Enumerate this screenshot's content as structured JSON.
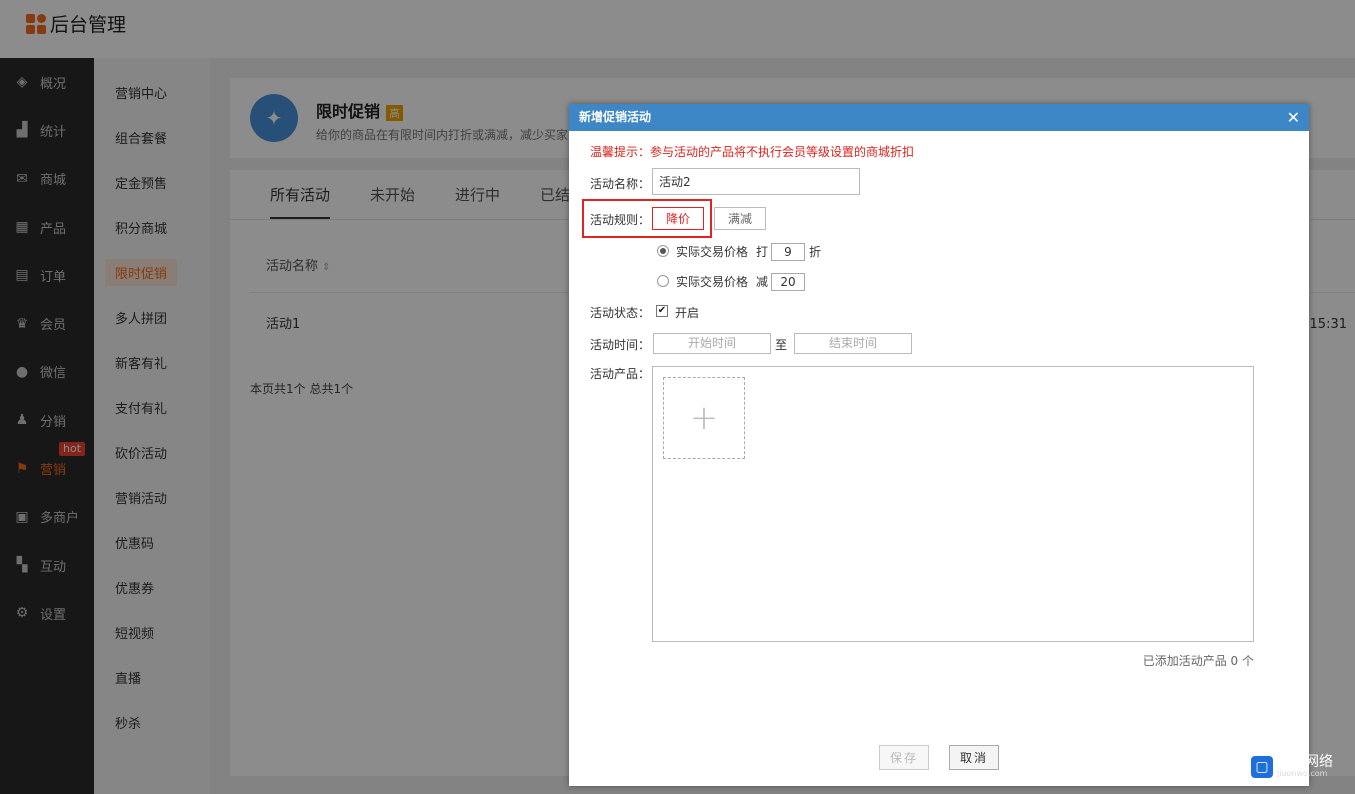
{
  "app": {
    "title": "后台管理"
  },
  "nav_main": [
    {
      "label": "概况",
      "icon": "layers-icon"
    },
    {
      "label": "统计",
      "icon": "chart-icon"
    },
    {
      "label": "商城",
      "icon": "mail-icon"
    },
    {
      "label": "产品",
      "icon": "grid-icon"
    },
    {
      "label": "订单",
      "icon": "clipboard-icon"
    },
    {
      "label": "会员",
      "icon": "crown-icon"
    },
    {
      "label": "微信",
      "icon": "wechat-icon"
    },
    {
      "label": "分销",
      "icon": "users-icon"
    },
    {
      "label": "营销",
      "icon": "flag-icon",
      "badge": "hot"
    },
    {
      "label": "多商户",
      "icon": "shop-icon"
    },
    {
      "label": "互动",
      "icon": "interact-icon"
    },
    {
      "label": "设置",
      "icon": "gear-icon"
    }
  ],
  "nav_sub": [
    "营销中心",
    "组合套餐",
    "定金预售",
    "积分商城",
    "限时促销",
    "多人拼团",
    "新客有礼",
    "支付有礼",
    "砍价活动",
    "营销活动",
    "优惠码",
    "优惠券",
    "短视频",
    "直播",
    "秒杀"
  ],
  "promo": {
    "title": "限时促销",
    "tag": "高",
    "desc": "给你的商品在有限时间内打折或满减，减少买家"
  },
  "tabs": [
    "所有活动",
    "未开始",
    "进行中",
    "已结"
  ],
  "table": {
    "header_name": "活动名称",
    "rows": [
      {
        "name": "活动1",
        "time": "15:31"
      }
    ]
  },
  "pager": "本页共1个 总共1个",
  "modal": {
    "title": "新增促销活动",
    "tip": "温馨提示：参与活动的产品将不执行会员等级设置的商城折扣",
    "name_label": "活动名称：",
    "name_value": "活动2",
    "rule_label": "活动规则：",
    "rule_options": [
      "降价",
      "满减"
    ],
    "rule_selected": "降价",
    "price_label": "实际交易价格",
    "discount_prefix": "打",
    "discount_value": "9",
    "discount_suffix": "折",
    "reduce_prefix": "减",
    "reduce_value": "20",
    "status_label": "活动状态：",
    "status_option": "开启",
    "status_checked": true,
    "time_label": "活动时间：",
    "start_placeholder": "开始时间",
    "time_sep": "至",
    "end_placeholder": "结束时间",
    "product_label": "活动产品：",
    "added_count": "已添加活动产品 0 个",
    "save": "保存",
    "cancel": "取消"
  },
  "watermark": {
    "text": "久安网络",
    "sub": "jiuonwo.com"
  }
}
